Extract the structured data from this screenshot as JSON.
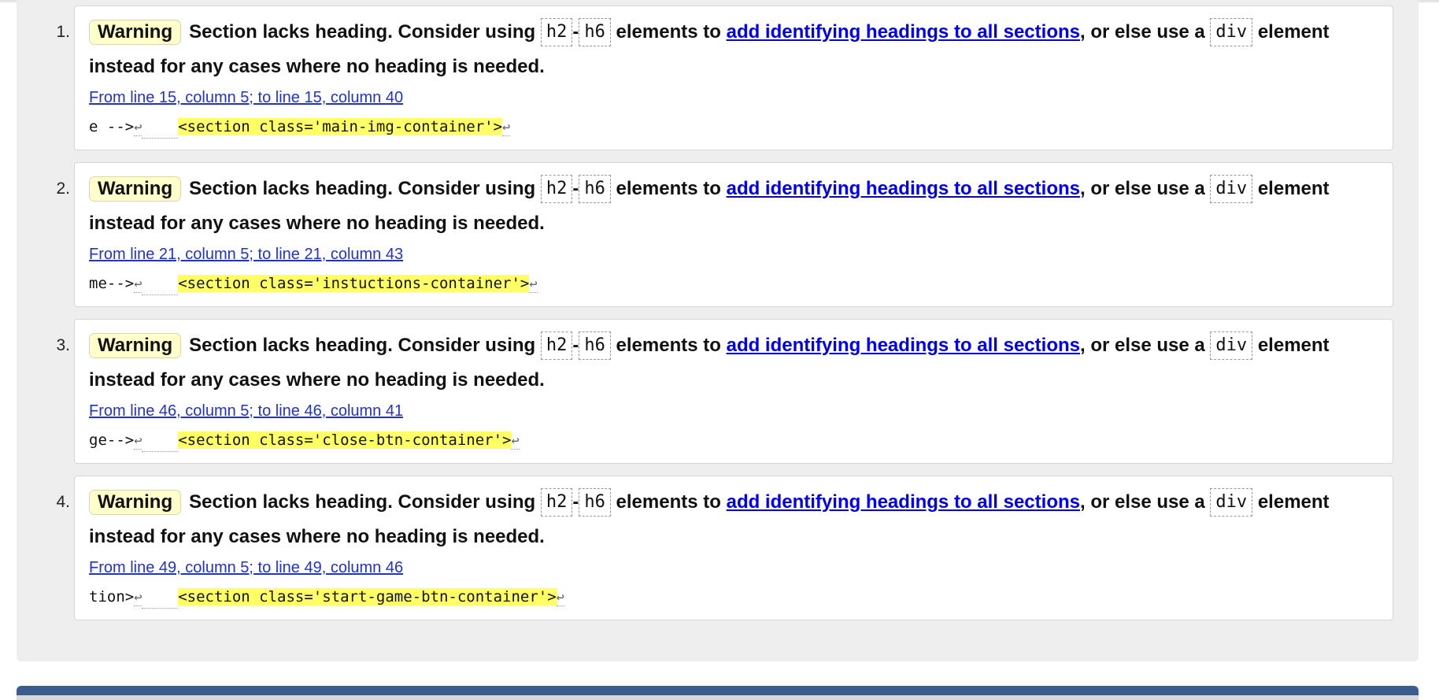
{
  "messages": [
    {
      "number": "1.",
      "badge": "Warning",
      "text_before": "Section lacks heading. Consider using ",
      "code_h2": "h2",
      "dash": "-",
      "code_h6": "h6",
      "text_mid": " elements to ",
      "link_text": "add identifying headings to all sections",
      "text_after": ", or else use a ",
      "code_div": "div",
      "text_end": " element instead for any cases where no heading is needed.",
      "location": "From line 15, column 5; to line 15, column 40",
      "extract_pre": "e -->",
      "extract_gap": "    ",
      "extract_hl": "<section class='main-img-container'>",
      "lf_symbol": "↩"
    },
    {
      "number": "2.",
      "badge": "Warning",
      "text_before": "Section lacks heading. Consider using ",
      "code_h2": "h2",
      "dash": "-",
      "code_h6": "h6",
      "text_mid": " elements to ",
      "link_text": "add identifying headings to all sections",
      "text_after": ", or else use a ",
      "code_div": "div",
      "text_end": " element instead for any cases where no heading is needed.",
      "location": "From line 21, column 5; to line 21, column 43",
      "extract_pre": "me-->",
      "extract_gap": "    ",
      "extract_hl": "<section class='instuctions-container'>",
      "lf_symbol": "↩"
    },
    {
      "number": "3.",
      "badge": "Warning",
      "text_before": "Section lacks heading. Consider using ",
      "code_h2": "h2",
      "dash": "-",
      "code_h6": "h6",
      "text_mid": " elements to ",
      "link_text": "add identifying headings to all sections",
      "text_after": ", or else use a ",
      "code_div": "div",
      "text_end": " element instead for any cases where no heading is needed.",
      "location": "From line 46, column 5; to line 46, column 41",
      "extract_pre": "ge-->",
      "extract_gap": "    ",
      "extract_hl": "<section class='close-btn-container'>",
      "lf_symbol": "↩"
    },
    {
      "number": "4.",
      "badge": "Warning",
      "text_before": "Section lacks heading. Consider using ",
      "code_h2": "h2",
      "dash": "-",
      "code_h6": "h6",
      "text_mid": " elements to ",
      "link_text": "add identifying headings to all sections",
      "text_after": ", or else use a ",
      "code_div": "div",
      "text_end": " element instead for any cases where no heading is needed.",
      "location": "From line 49, column 5; to line 49, column 46",
      "extract_pre": "tion>",
      "extract_gap": "    ",
      "extract_hl": "<section class='start-game-btn-container'>",
      "lf_symbol": "↩"
    }
  ]
}
